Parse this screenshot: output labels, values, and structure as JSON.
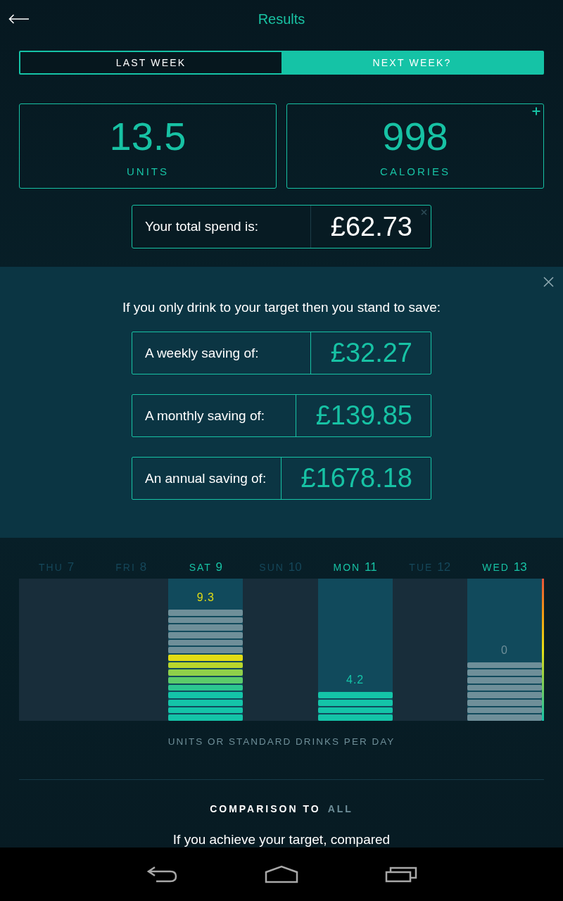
{
  "header": {
    "title": "Results"
  },
  "tabs": [
    {
      "label": "LAST WEEK",
      "selected": false
    },
    {
      "label": "NEXT WEEK?",
      "selected": true
    }
  ],
  "stats": [
    {
      "value": "13.5",
      "label": "UNITS",
      "add_button": false
    },
    {
      "value": "998",
      "label": "CALORIES",
      "add_button": true
    }
  ],
  "spend": {
    "label": "Your total spend is:",
    "value": "£62.73",
    "dismissible": true
  },
  "savings": {
    "intro": "If you only drink to your target then you stand to save:",
    "items": [
      {
        "label": "A weekly saving of:",
        "value": "£32.27"
      },
      {
        "label": "A monthly saving of:",
        "value": "£139.85"
      },
      {
        "label": "An annual saving of:",
        "value": "£1678.18"
      }
    ]
  },
  "chart": {
    "days": [
      {
        "day": "THU",
        "date": "7",
        "logged": false
      },
      {
        "day": "FRI",
        "date": "8",
        "logged": false
      },
      {
        "day": "SAT",
        "date": "9",
        "logged": true,
        "value": "9.3",
        "color": "#e2dc14",
        "segments": [
          {
            "color": "#6f8f99"
          },
          {
            "color": "#6f8f99"
          },
          {
            "color": "#6f8f99"
          },
          {
            "color": "#6f8f99"
          },
          {
            "color": "#6f8f99"
          },
          {
            "color": "#6f8f99"
          },
          {
            "color": "#e2dc14"
          },
          {
            "color": "#b9d72c"
          },
          {
            "color": "#8fd04a"
          },
          {
            "color": "#5ccb6a"
          },
          {
            "color": "#2cc690"
          },
          {
            "color": "#14c4a8"
          },
          {
            "color": "#14c4a8"
          },
          {
            "color": "#14c4a8"
          },
          {
            "color": "#14c4a8"
          }
        ]
      },
      {
        "day": "SUN",
        "date": "10",
        "logged": false
      },
      {
        "day": "MON",
        "date": "11",
        "logged": true,
        "value": "4.2",
        "color": "#14c4a8",
        "segments": [
          {
            "color": "#14c4a8"
          },
          {
            "color": "#14c4a8"
          },
          {
            "color": "#14c4a8"
          },
          {
            "color": "#14c4a8"
          }
        ]
      },
      {
        "day": "TUE",
        "date": "12",
        "logged": false
      },
      {
        "day": "WED",
        "date": "13",
        "logged": true,
        "value": "0",
        "color": "#6f8f99",
        "segments": [
          {
            "color": "#6f8f99"
          },
          {
            "color": "#6f8f99"
          },
          {
            "color": "#6f8f99"
          },
          {
            "color": "#6f8f99"
          },
          {
            "color": "#6f8f99"
          },
          {
            "color": "#6f8f99"
          },
          {
            "color": "#6f8f99"
          },
          {
            "color": "#6f8f99"
          }
        ]
      }
    ],
    "caption": "UNITS OR STANDARD DRINKS PER DAY"
  },
  "comparison": {
    "title": "COMPARISON TO",
    "filter": "ALL",
    "text": "If you achieve your target, compared"
  }
}
